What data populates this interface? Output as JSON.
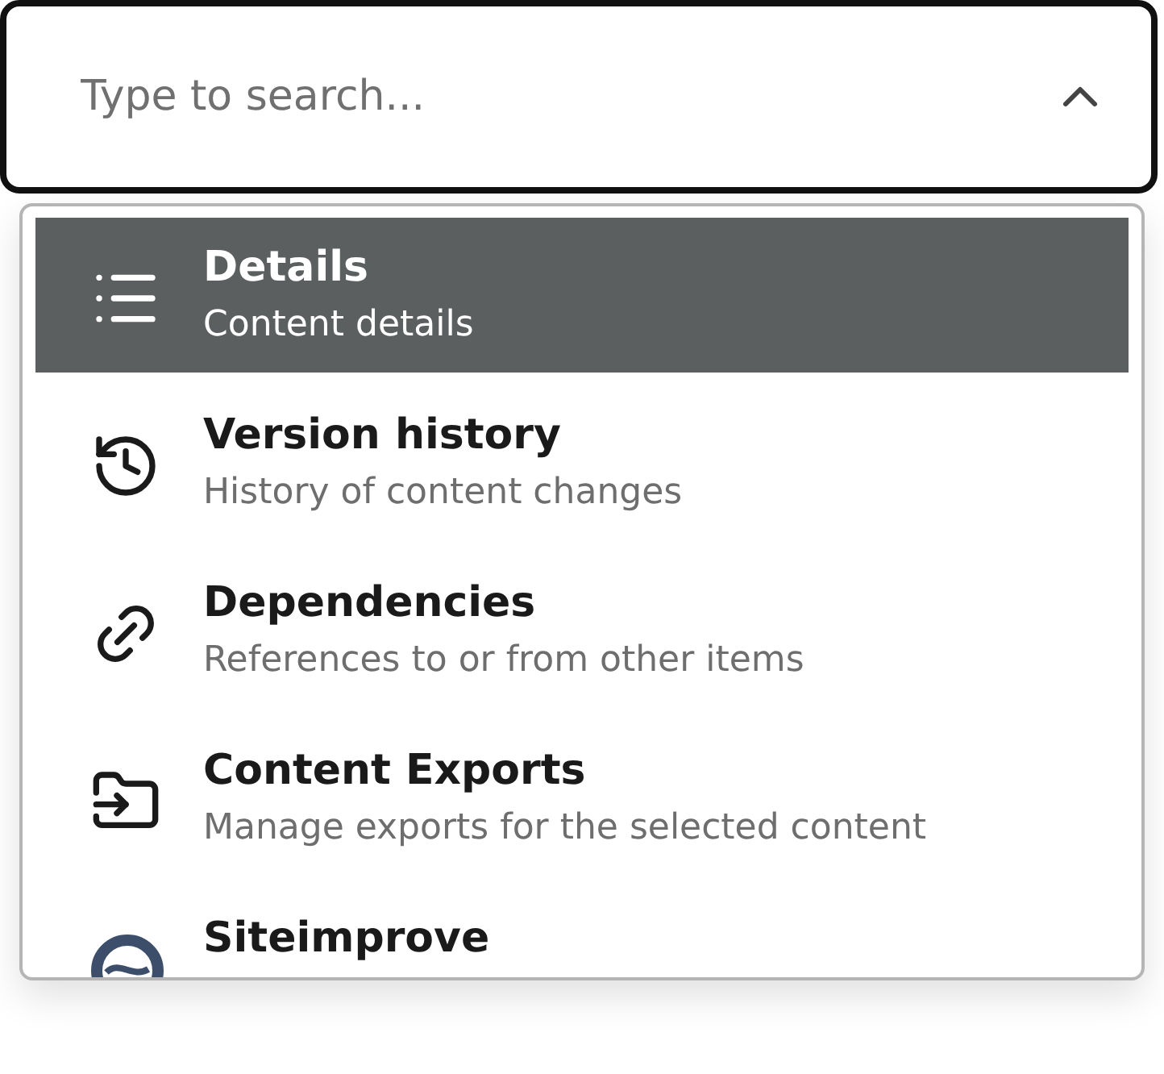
{
  "search": {
    "placeholder": "Type to search...",
    "expanded": true
  },
  "items": [
    {
      "title": "Details",
      "description": "Content details",
      "selected": true
    },
    {
      "title": "Version history",
      "description": "History of content changes",
      "selected": false
    },
    {
      "title": "Dependencies",
      "description": "References to or from other items",
      "selected": false
    },
    {
      "title": "Content Exports",
      "description": "Manage exports for the selected content",
      "selected": false
    },
    {
      "title": "Siteimprove",
      "selected": false
    }
  ]
}
